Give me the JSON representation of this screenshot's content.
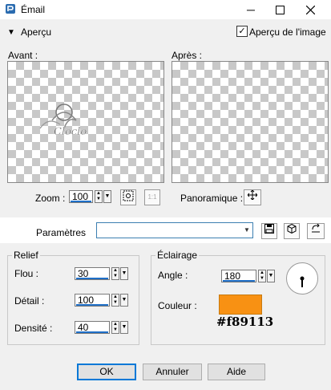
{
  "window": {
    "title": "Émail"
  },
  "section": {
    "label": "Aperçu",
    "preview_check_label": "Aperçu de l'image",
    "preview_checked": true
  },
  "preview": {
    "before_label": "Avant :",
    "after_label": "Après :",
    "watermark_text": "Cloclo"
  },
  "zoom": {
    "label": "Zoom :",
    "value": "100",
    "one_to_one_label": "1:1"
  },
  "pan": {
    "label": "Panoramique :"
  },
  "params": {
    "label": "Paramètres",
    "value": ""
  },
  "relief": {
    "title": "Relief",
    "blur_label": "Flou :",
    "blur_value": "30",
    "detail_label": "Détail :",
    "detail_value": "100",
    "density_label": "Densité :",
    "density_value": "40"
  },
  "lighting": {
    "title": "Éclairage",
    "angle_label": "Angle :",
    "angle_value": "180",
    "color_label": "Couleur :",
    "color_hex": "#f89113",
    "color_text": "#f89113"
  },
  "buttons": {
    "ok": "OK",
    "cancel": "Annuler",
    "help": "Aide"
  }
}
